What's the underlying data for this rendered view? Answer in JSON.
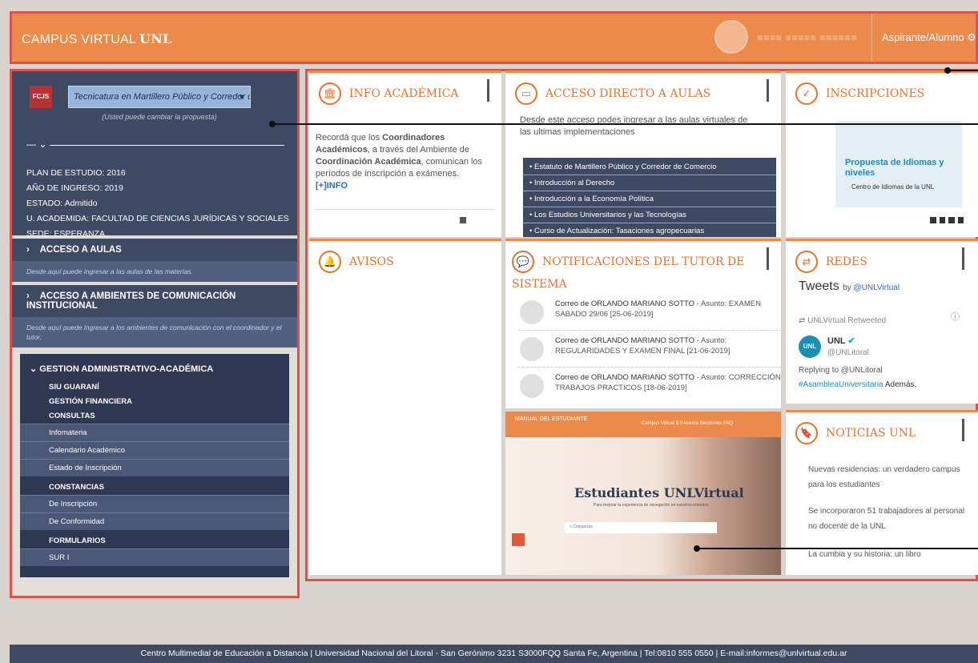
{
  "header": {
    "brand_prefix": "CAMPUS VIRTUAL",
    "brand_bold": "UNL",
    "role": "Aspirante/Alumno",
    "settings_icon": "gear-icon"
  },
  "sidebar": {
    "logo": "FCJS",
    "career_select": "Tecnicatura en Martillero Público y Corredor de",
    "career_hint": "(Usted puede cambiar la propuesta)",
    "profile": {
      "plan": "PLAN DE ESTUDIO: 2016",
      "ingreso": "AÑO DE INGRESO: 2019",
      "estado": "ESTADO: Admitido",
      "academia": "U. ACADEMIDA: FACULTAD DE CIENCIAS JURÍDICAS Y SOCIALES",
      "sede": "SEDE: ESPERANZA"
    },
    "acceso_aulas": {
      "label": "ACCESO A AULAS",
      "desc": "Desde aquí puede ingresar a las aulas de las materias."
    },
    "acceso_ambientes": {
      "label": "ACCESO A AMBIENTES DE COMUNICACIÓN INSTITUCIONAL",
      "desc": "Desde aquí puede ingresar a los ambientes de comunicación con el coordinador y el tutor."
    },
    "gestion": {
      "label": "GESTION ADMINISTRATIVO-ACADÉMICA",
      "siu": "SIU GUARANÍ",
      "financiera": "GESTIÓN FINANCIERA",
      "consultas": "CONSULTAS",
      "consultas_items": [
        "Infomateria",
        "Calendario Académico",
        "Estado de Inscripción"
      ],
      "constancias": "CONSTANCIAS",
      "constancias_items": [
        "De Inscripción",
        "De Conformidad"
      ],
      "formularios": "FORMULARIOS",
      "formularios_items": [
        "SUR I"
      ]
    }
  },
  "cards": {
    "info": {
      "title": "INFO ACADÉMICA",
      "t1": "Recordá que los ",
      "b1": "Coordinadores Académicos",
      "t2": ", a través del Ambiente de ",
      "b2": "Coordinación Académica",
      "t3": ", comunican los períodos de inscripción a exámenes.",
      "more": "[+]INFO"
    },
    "aulas": {
      "title": "ACCESO DIRECTO A AULAS",
      "desc": "Desde este acceso podes ingresar a las aulas virtuales de las ultimas implementaciones",
      "items": [
        "Estatuto de Martillero Público y Corredor de Comercio",
        "Introducción al Derecho",
        "Introducción a la Economía Política",
        "Los Estudios Universitarios y las Tecnologías",
        "Curso de Actualización: Tasaciones agropecuarias"
      ]
    },
    "inscripciones": {
      "title": "INSCRIPCIONES",
      "banner_title": "Propuesta de Idiomas y niveles",
      "banner_sub": "Centro de Idiomas de la UNL"
    },
    "avisos": {
      "title": "AVISOS"
    },
    "tutor": {
      "title1": "NOTIFICACIONES DEL TUTOR DE",
      "title2": "SISTEMA",
      "items": [
        {
          "from": "Correo de ORLANDO MARIANO SOTTO",
          "subject": " - Asunto: EXAMEN SABADO 29/06 [25-06-2019]"
        },
        {
          "from": "Correo de ORLANDO MARIANO SOTTO",
          "subject": " - Asunto: REGULARIDADES Y EXAMEN FINAL [21-06-2019]"
        },
        {
          "from": "Correo de ORLANDO MARIANO SOTTO",
          "subject": " - Asunto: CORRECCIÓN TRABAJOS PRACTICOS [18-06-2019]"
        }
      ]
    },
    "redes": {
      "title": "REDES",
      "tweets": "Tweets",
      "by": "by ",
      "handle": "@UNLVirtual",
      "retweeted": "UNLVirtual Retweeted",
      "account": "UNL",
      "account_handle": "@UNLitoral",
      "reply": "Replying to @UNLitoral",
      "tag": "#AsambleaUniversitaria",
      "tweet_text": " Además,"
    },
    "noticias": {
      "title": "NOTICIAS UNL",
      "items": [
        "Nuevas residencias: un verdadero campus para los estudiantes",
        "Se incorporaron 51 trabajadores al personal no docente de la UNL",
        "La cumbia y su historia: un libro"
      ]
    },
    "manual": {
      "brand": "MANUAL DEL ESTUDIANTE",
      "nav": "Campus Virtual 3.0   Acerca   Secciones   FAQ",
      "title": "Estudiantes UNLVirtual",
      "subtitle": "Para mejorar tu experiencia de navegación en nuestros entornos",
      "search": "Categorías"
    }
  },
  "footer": {
    "text": "Centro Multimedial de Educación a Distancia | Universidad Nacional del Litoral - San Gerónimo 3231 S3000FQQ Santa Fe, Argentina | Tel:0810 555 0550 | E-mail:informes@unlvirtual.edu.ar"
  }
}
